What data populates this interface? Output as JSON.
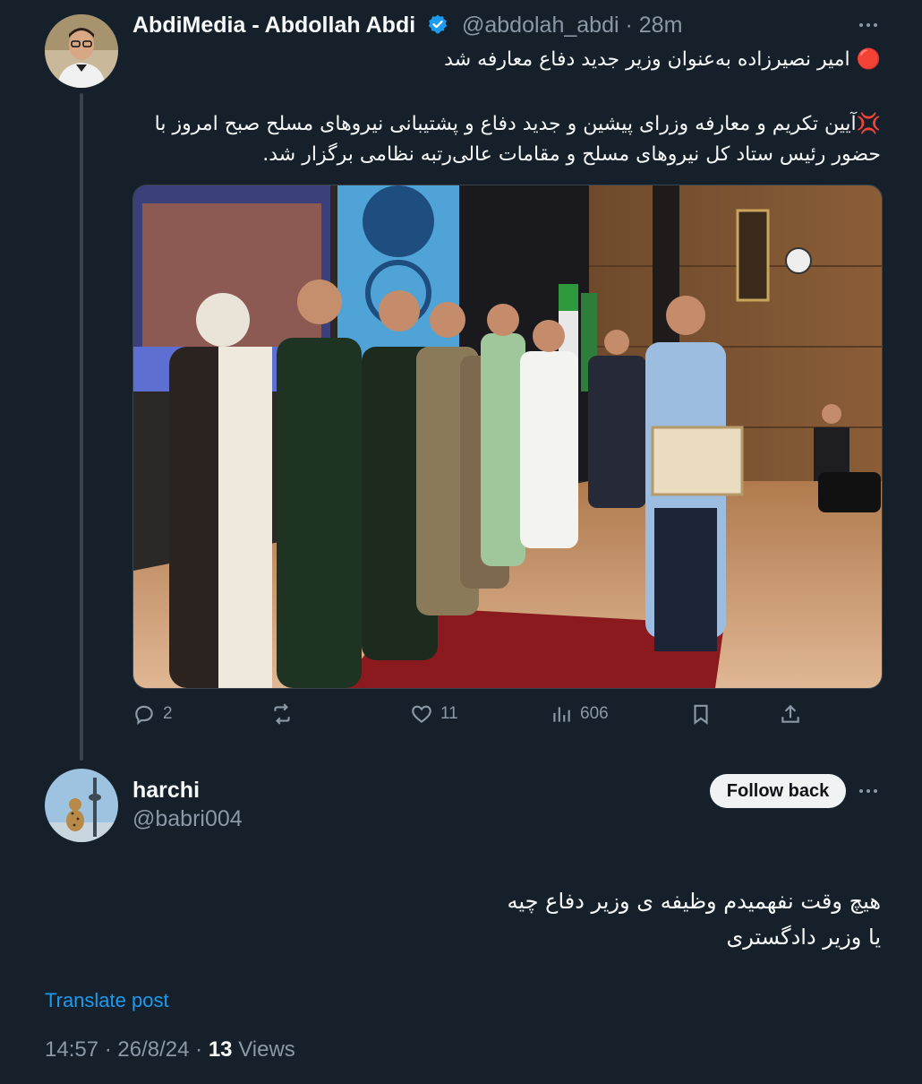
{
  "tweet": {
    "author_name": "AbdiMedia - Abdollah Abdi",
    "author_handle": "@abdolah_abdi",
    "dot": "·",
    "time_ago": "28m",
    "verified_icon": "verified-badge-icon",
    "line1": "🔴 امیر نصیرزاده به‌عنوان وزیر جدید دفاع معارفه شد",
    "line2": "💢آیین تکریم و معارفه وزرای پیشین و جدید دفاع و پشتیبانی نیروهای مسلح صبح امروز با حضور رئیس ستاد کل نیروهای مسلح و مقامات عالی‌رتبه نظامی برگزار شد.",
    "image_icon": "ceremony-photo",
    "actions": {
      "reply_count": "2",
      "repost_count": "",
      "like_count": "11",
      "views_count": "606"
    }
  },
  "reply": {
    "author_name": "harchi",
    "author_handle": "@babri004",
    "follow_label": "Follow back",
    "text_line1": "هیچ وقت نفهمیدم وظیفه ی وزیر دفاع چیه",
    "text_line2": "یا وزیر دادگستری",
    "translate_label": "Translate post",
    "time": "14:57",
    "date": "26/8/24",
    "sep": "·",
    "views_count": "13",
    "views_label": "Views"
  },
  "colors": {
    "background": "#15202b",
    "text": "#f7f9f9",
    "muted": "#8b98a5",
    "accent": "#1d9bf0"
  }
}
